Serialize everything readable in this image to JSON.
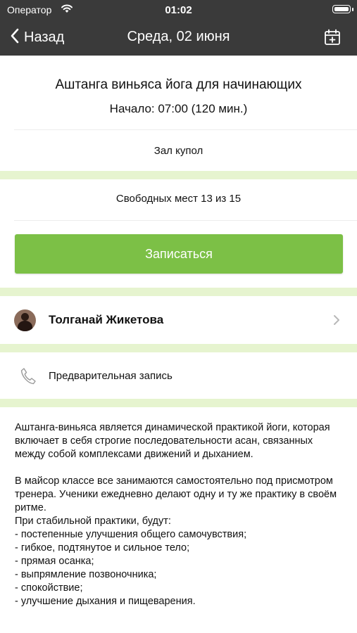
{
  "status_bar": {
    "carrier": "Оператор",
    "time": "01:02"
  },
  "nav": {
    "back_label": "Назад",
    "title": "Среда, 02 июня"
  },
  "event": {
    "title": "Аштанга виньяса йога для начинающих",
    "start": "Начало: 07:00 (120 мин.)",
    "hall": "Зал купол",
    "seats": "Свободных мест 13 из 15"
  },
  "signup_button": "Записаться",
  "trainer": {
    "name": "Толганай Жикетова"
  },
  "booking": {
    "label": "Предварительная запись"
  },
  "description": "Аштанга-виньяса является динамической практикой йоги, которая включает в себя строгие последовательности асан, связанных между собой комплексами движений и дыханием.\n\nВ майсор классе все занимаются самостоятельно под присмотром тренера. Ученики ежедневно делают одну и ту же практику в своём ритме.\nПри стабильной практики, будут:\n- постепенные улучшения общего самочувствия;\n- гибкое, подтянутое и сильное тело;\n- прямая осанка;\n- выпрямление позвоночника;\n- спокойствие;\n- улучшение дыхания и пищеварения.",
  "colors": {
    "header_bg": "#3a3a3a",
    "accent_green": "#7cc046",
    "separator_green": "#e6f4cf"
  },
  "icons": [
    "wifi-icon",
    "battery-icon",
    "back-chevron-icon",
    "calendar-add-icon",
    "avatar",
    "chevron-right-icon",
    "phone-icon"
  ]
}
